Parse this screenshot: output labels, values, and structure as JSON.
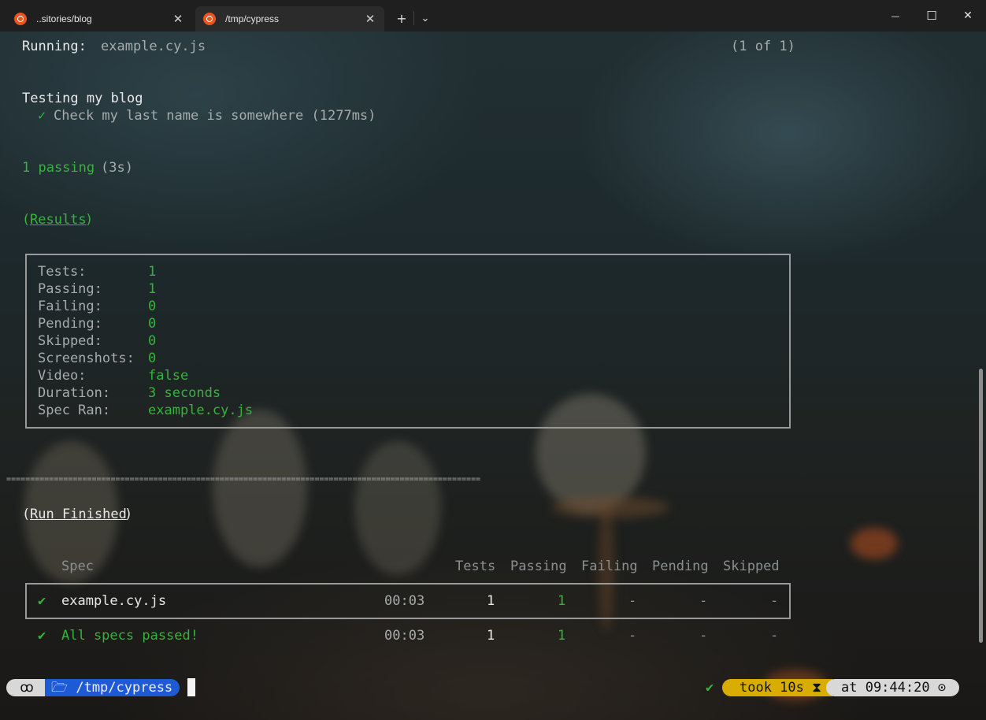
{
  "window": {
    "tabs": [
      {
        "label": "..sitories/blog",
        "icon": "ubuntu-icon"
      },
      {
        "label": "/tmp/cypress",
        "icon": "ubuntu-icon"
      }
    ],
    "new_tab": "+",
    "dropdown": "⌄",
    "minimize": "—",
    "maximize": "☐",
    "close": "✕",
    "tab_close": "✕"
  },
  "terminal": {
    "running_label": "Running:",
    "running_file": "example.cy.js",
    "running_count": "(1 of 1)",
    "suite_title": "Testing my blog",
    "test_check": "✓",
    "test_name": "Check my last name is somewhere (1277ms)",
    "passing_text": "1 passing",
    "passing_time": "(3s)",
    "results_open": "(",
    "results_label": "Results",
    "results_close": ")",
    "results": [
      {
        "key": "Tests:",
        "value": "1"
      },
      {
        "key": "Passing:",
        "value": "1"
      },
      {
        "key": "Failing:",
        "value": "0"
      },
      {
        "key": "Pending:",
        "value": "0"
      },
      {
        "key": "Skipped:",
        "value": "0"
      },
      {
        "key": "Screenshots:",
        "value": "0"
      },
      {
        "key": "Video:",
        "value": "false"
      },
      {
        "key": "Duration:",
        "value": "3 seconds"
      },
      {
        "key": "Spec Ran:",
        "value": "example.cy.js"
      }
    ],
    "divider": "====================================================================================================",
    "run_open": "(",
    "run_label": "Run Finished",
    "run_close": ")",
    "headers": {
      "spec": "Spec",
      "tests": "Tests",
      "passing": "Passing",
      "failing": "Failing",
      "pending": "Pending",
      "skipped": "Skipped"
    },
    "rows": [
      {
        "check": "✔",
        "spec": "example.cy.js",
        "time": "00:03",
        "tests": "1",
        "passing": "1",
        "failing": "-",
        "pending": "-",
        "skipped": "-"
      },
      {
        "check": "✔",
        "spec": "All specs passed!",
        "time": "00:03",
        "tests": "1",
        "passing": "1",
        "failing": "-",
        "pending": "-",
        "skipped": "-"
      }
    ]
  },
  "prompt": {
    "os_icon": "ꝏ",
    "folder_icon": "🗁",
    "path": "/tmp/cypress",
    "status_check": "✔",
    "took": "took 10s",
    "hourglass": "⧗",
    "at": "at 09:44:20",
    "clock": "⊙"
  },
  "colors": {
    "accent_green": "#34b43a",
    "path_blue": "#1f5ad6",
    "took_yellow": "#d9ad00",
    "ubuntu_orange": "#e95420"
  }
}
